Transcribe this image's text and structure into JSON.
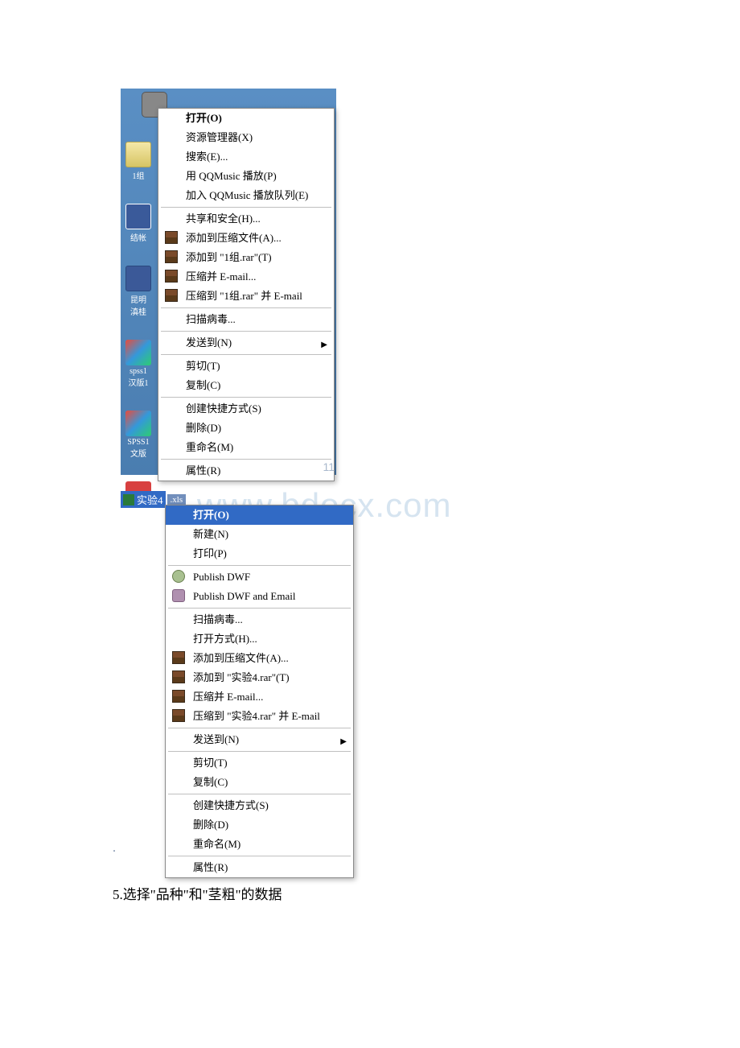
{
  "desktop_icons": {
    "folder_label": "1组",
    "shortcut_label": "结帐",
    "word_label": "昆明\n滇桂",
    "colorful1_label": "spss1\n汉版1",
    "colorful2_label": "SPSS1\n文版"
  },
  "menu1": {
    "open": "打开(O)",
    "explorer": "资源管理器(X)",
    "search": "搜索(E)...",
    "qqmusic_play": "用 QQMusic 播放(P)",
    "qqmusic_queue": "加入 QQMusic 播放队列(E)",
    "share": "共享和安全(H)...",
    "add_archive": "添加到压缩文件(A)...",
    "add_to_rar": "添加到 \"1组.rar\"(T)",
    "compress_email": "压缩并 E-mail...",
    "compress_to_email": "压缩到 \"1组.rar\" 并 E-mail",
    "scan_virus": "扫描病毒...",
    "send_to": "发送到(N)",
    "cut": "剪切(T)",
    "copy": "复制(C)",
    "create_shortcut": "创建快捷方式(S)",
    "delete": "删除(D)",
    "rename": "重命名(M)",
    "properties": "属性(R)"
  },
  "page_number": "11",
  "file": {
    "name": "实验4",
    "ext": ".xls"
  },
  "menu2": {
    "open": "打开(O)",
    "new": "新建(N)",
    "print": "打印(P)",
    "publish_dwf": "Publish DWF",
    "publish_dwf_email": "Publish DWF and Email",
    "scan_virus": "扫描病毒...",
    "open_with": "打开方式(H)...",
    "add_archive": "添加到压缩文件(A)...",
    "add_to_rar": "添加到 \"实验4.rar\"(T)",
    "compress_email": "压缩并 E-mail...",
    "compress_to_email": "压缩到 \"实验4.rar\" 并 E-mail",
    "send_to": "发送到(N)",
    "cut": "剪切(T)",
    "copy": "复制(C)",
    "create_shortcut": "创建快捷方式(S)",
    "delete": "删除(D)",
    "rename": "重命名(M)",
    "properties": "属性(R)"
  },
  "watermark": "www.bdocx.com",
  "bottom_text": "5.选择\"品种\"和\"茎粗\"的数据"
}
